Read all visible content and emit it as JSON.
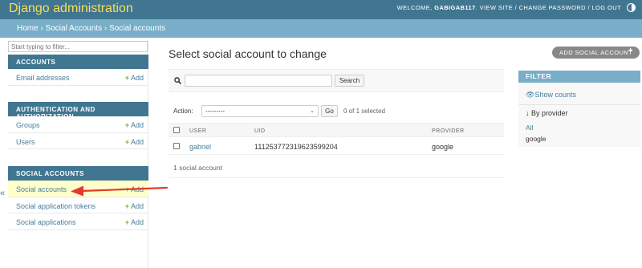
{
  "header": {
    "brand": "Django administration",
    "welcome_prefix": "Welcome, ",
    "username": "gabigab117",
    "links_text": ". View site / Change password / Log out"
  },
  "breadcrumbs": "Home › Social Accounts › Social accounts",
  "nav": {
    "filter_placeholder": "Start typing to filter...",
    "collapse_icon": "«",
    "modules": [
      {
        "caption": "Accounts",
        "rows": [
          {
            "label": "Email addresses",
            "add": "Add"
          }
        ]
      },
      {
        "caption": "Authentication and Authorization",
        "rows": [
          {
            "label": "Groups",
            "add": "Add"
          },
          {
            "label": "Users",
            "add": "Add"
          }
        ]
      },
      {
        "caption": "Social Accounts",
        "rows": [
          {
            "label": "Social accounts",
            "add": "Add"
          },
          {
            "label": "Social application tokens",
            "add": "Add"
          },
          {
            "label": "Social applications",
            "add": "Add"
          }
        ]
      }
    ]
  },
  "content": {
    "title": "Select social account to change",
    "add_button": "Add social account",
    "search_button": "Search",
    "action_label": "Action:",
    "action_selected": "---------",
    "go_button": "Go",
    "selection_counter": "0 of 1 selected",
    "columns": [
      "User",
      "UID",
      "Provider"
    ],
    "rows": [
      {
        "user": "gabriel",
        "uid": "111253772319623599204",
        "provider": "google"
      }
    ],
    "paginator": "1 social account"
  },
  "filter": {
    "caption": "Filter",
    "show_counts": "Show counts",
    "by_provider": "By provider",
    "choices": [
      "All",
      "google"
    ]
  },
  "colors": {
    "header_bg": "#417690",
    "brand": "#f5dd5d",
    "breadcrumbs_bg": "#79aec8",
    "link": "#447e9b",
    "add_plus": "#70bf2b",
    "selected_row": "#ffffcc",
    "annotation_arrow": "#e53a2a"
  },
  "icons": {
    "theme": "theme-toggle-icon",
    "search": "search-icon",
    "show_counts": "eye-icon",
    "by_provider": "arrow-down-icon",
    "annotation": "red-arrow-annotation"
  }
}
